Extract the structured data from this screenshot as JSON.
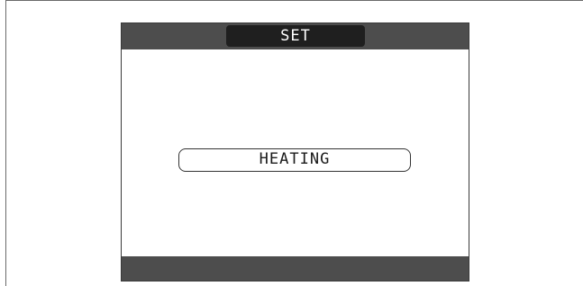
{
  "screen": {
    "title": "SET",
    "selected_option": "HEATING"
  },
  "colors": {
    "bar": "#4d4d4d",
    "title_pill": "#1f1f1f",
    "background": "#ffffff"
  }
}
